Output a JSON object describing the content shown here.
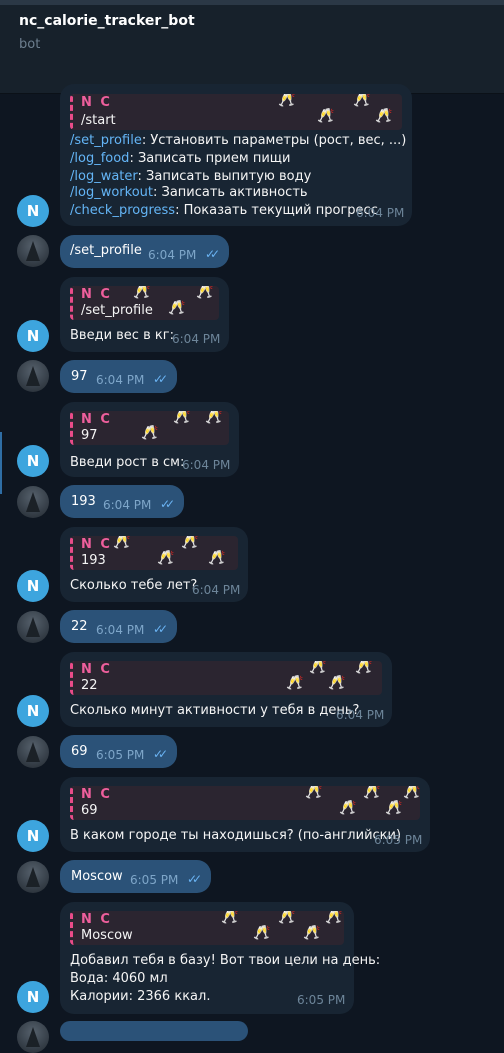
{
  "header": {
    "title": "nc_calorie_tracker_bot",
    "subtitle": "bot"
  },
  "bot_avatar_letter": "N",
  "quote_name": "N C",
  "colors": {
    "background": "#0e1621",
    "incoming": "#182533",
    "outgoing": "#2b5278",
    "accent": "#ea4c89"
  },
  "messages": {
    "m1": {
      "quote_text": "/start",
      "commands": [
        {
          "cmd": "/set_profile",
          "desc": ": Установить параметры (рост, вес, ...)"
        },
        {
          "cmd": "/log_food",
          "desc": ": Записать прием пищи"
        },
        {
          "cmd": "/log_water",
          "desc": ": Записать выпитую воду"
        },
        {
          "cmd": "/log_workout",
          "desc": ": Записать активность"
        },
        {
          "cmd": "/check_progress",
          "desc": ": Показать текущий прогресс"
        }
      ],
      "time": "6:04 PM"
    },
    "u1": {
      "text": "/set_profile",
      "time": "6:04 PM"
    },
    "m2": {
      "quote_text": "/set_profile",
      "text": "Введи вес в кг:",
      "time": "6:04 PM"
    },
    "u2": {
      "text": "97",
      "time": "6:04 PM"
    },
    "m3": {
      "quote_text": "97",
      "text": "Введи рост в см:",
      "time": "6:04 PM"
    },
    "u3": {
      "text": "193",
      "time": "6:04 PM"
    },
    "m4": {
      "quote_text": "193",
      "text": "Сколько тебе лет?",
      "time": "6:04 PM"
    },
    "u4": {
      "text": "22",
      "time": "6:04 PM"
    },
    "m5": {
      "quote_text": "22",
      "text": "Сколько минут активности у тебя в день?",
      "time": "6:04 PM"
    },
    "u5": {
      "text": "69",
      "time": "6:05 PM"
    },
    "m6": {
      "quote_text": "69",
      "text": "В каком городе ты находишься? (по-английски)",
      "time": "6:05 PM"
    },
    "u6": {
      "text": "Moscow",
      "time": "6:05 PM"
    },
    "m7": {
      "quote_text": "Moscow",
      "lines": [
        "Добавил тебя в базу! Вот твои цели на день:",
        "Вода: 4060 мл",
        "Калории: 2366 ккал."
      ],
      "time": "6:05 PM"
    }
  }
}
